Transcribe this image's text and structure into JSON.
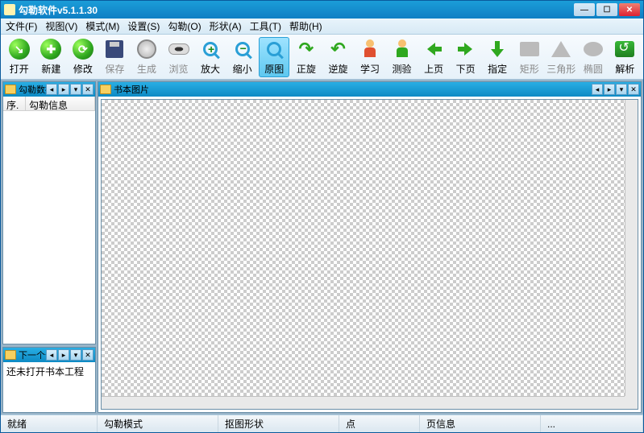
{
  "title": "勾勒软件v5.1.1.30",
  "menu": [
    "文件(F)",
    "视图(V)",
    "模式(M)",
    "设置(S)",
    "勾勒(O)",
    "形状(A)",
    "工具(T)",
    "帮助(H)"
  ],
  "toolbar": [
    {
      "id": "open",
      "label": "打开"
    },
    {
      "id": "new",
      "label": "新建"
    },
    {
      "id": "modify",
      "label": "修改"
    },
    {
      "id": "save",
      "label": "保存",
      "disabled": true
    },
    {
      "id": "generate",
      "label": "生成",
      "disabled": true
    },
    {
      "id": "browse",
      "label": "浏览",
      "disabled": true
    },
    {
      "id": "zoomin",
      "label": "放大"
    },
    {
      "id": "zoomout",
      "label": "缩小"
    },
    {
      "id": "original",
      "label": "原图",
      "selected": true
    },
    {
      "id": "rotcw",
      "label": "正旋"
    },
    {
      "id": "rotccw",
      "label": "逆旋"
    },
    {
      "id": "learn",
      "label": "学习"
    },
    {
      "id": "test",
      "label": "测验"
    },
    {
      "id": "prev",
      "label": "上页"
    },
    {
      "id": "next",
      "label": "下页"
    },
    {
      "id": "goto",
      "label": "指定"
    },
    {
      "id": "rect",
      "label": "矩形",
      "disabled": true
    },
    {
      "id": "tri",
      "label": "三角形",
      "disabled": true
    },
    {
      "id": "ellipse",
      "label": "椭圆",
      "disabled": true
    },
    {
      "id": "parse",
      "label": "解析"
    }
  ],
  "left_panel": {
    "title": "勾勒数据",
    "cols": [
      "序.",
      "勾勒信息"
    ]
  },
  "bottom_panel": {
    "title": "下一个勾",
    "text": "还未打开书本工程"
  },
  "canvas_panel": {
    "title": "书本图片"
  },
  "status": {
    "ready": "就绪",
    "mode": "勾勒模式",
    "shape": "抠图形状",
    "point": "点",
    "page": "页信息",
    "extra": "..."
  }
}
